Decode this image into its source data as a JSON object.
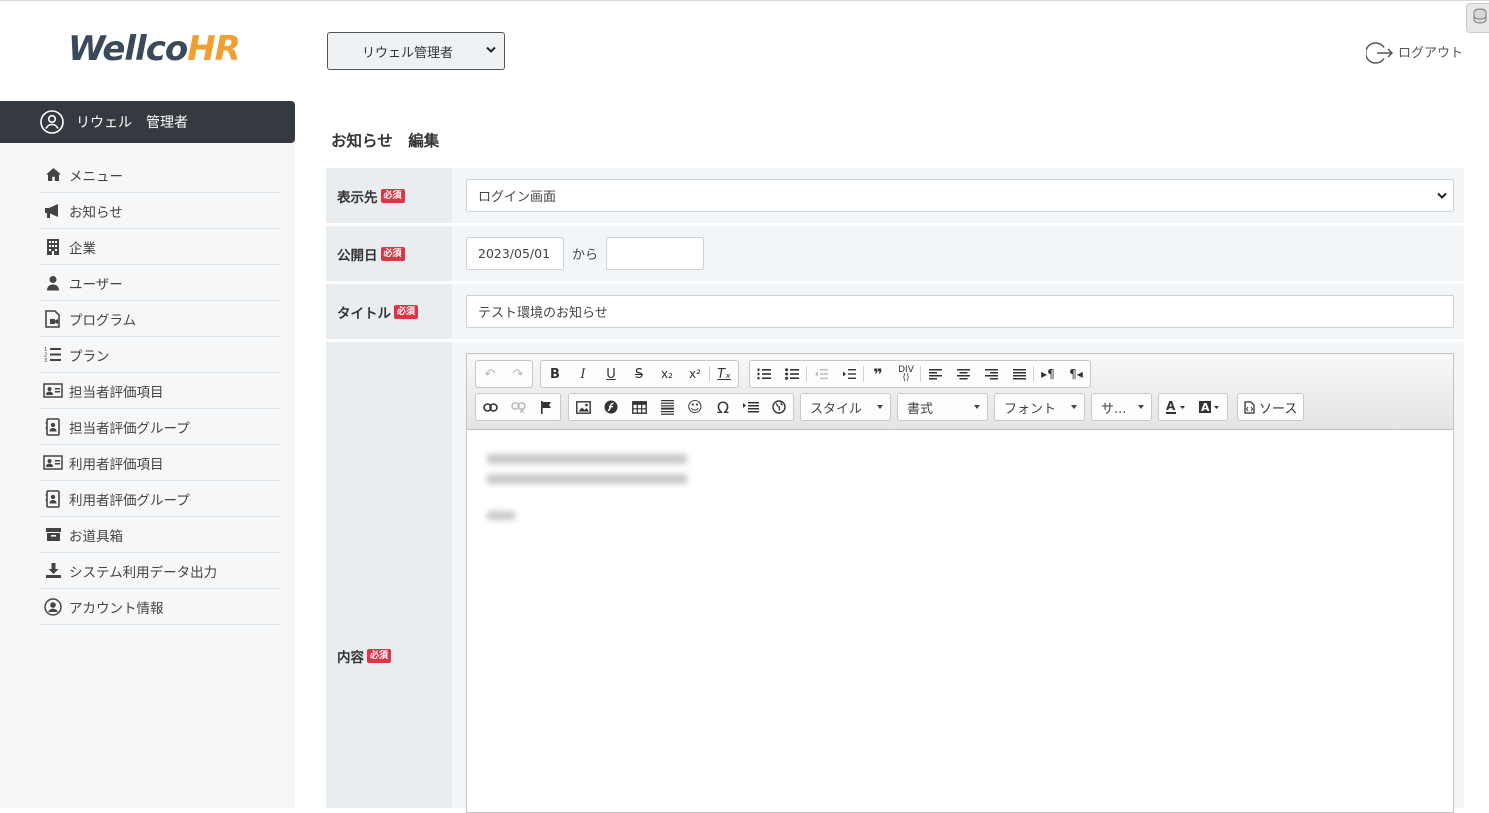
{
  "logo": {
    "wellco": "Wellco",
    "hr": "HR"
  },
  "user": {
    "name": "リウェル　管理者"
  },
  "sidebar": {
    "items": [
      {
        "label": "メニュー",
        "icon": "home-icon"
      },
      {
        "label": "お知らせ",
        "icon": "megaphone-icon"
      },
      {
        "label": "企業",
        "icon": "building-icon"
      },
      {
        "label": "ユーザー",
        "icon": "user-icon"
      },
      {
        "label": "プログラム",
        "icon": "program-file-icon"
      },
      {
        "label": "プラン",
        "icon": "numbered-list-icon"
      },
      {
        "label": "担当者評価項目",
        "icon": "id-card-icon"
      },
      {
        "label": "担当者評価グループ",
        "icon": "contact-book-icon"
      },
      {
        "label": "利用者評価項目",
        "icon": "id-card-icon"
      },
      {
        "label": "利用者評価グループ",
        "icon": "contact-book-icon"
      },
      {
        "label": "お道具箱",
        "icon": "archive-box-icon"
      },
      {
        "label": "システム利用データ出力",
        "icon": "download-icon"
      },
      {
        "label": "アカウント情報",
        "icon": "account-circle-icon"
      }
    ]
  },
  "header": {
    "role_select": "リウェル管理者",
    "logout": "ログアウト"
  },
  "page": {
    "title": "お知らせ　編集"
  },
  "form": {
    "required_badge": "必須",
    "display_target": {
      "label": "表示先",
      "value": "ログイン画面"
    },
    "publish_date": {
      "label": "公開日",
      "from": "2023/05/01",
      "sep": "から",
      "to": ""
    },
    "title": {
      "label": "タイトル",
      "value": "テスト環境のお知らせ"
    },
    "content": {
      "label": "内容"
    }
  },
  "editor": {
    "style_combo": "スタイル",
    "format_combo": "書式",
    "font_combo": "フォント",
    "size_combo": "サ...",
    "source_label": "ソース"
  },
  "colors": {
    "dark_bar": "#343a40",
    "badge": "#dc3545",
    "logo_orange": "#f0a030",
    "logo_navy": "#3a4a5a"
  }
}
